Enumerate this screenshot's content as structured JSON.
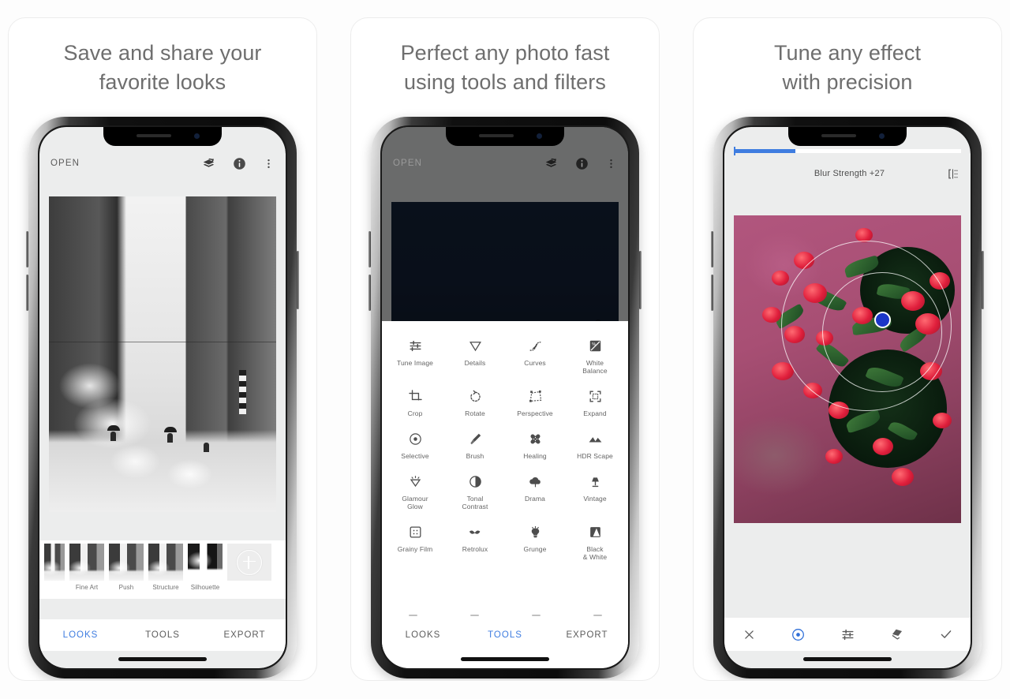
{
  "page": {
    "background": "#fdfdfd",
    "accent": "#3f7de0"
  },
  "cards": [
    {
      "id": "looks",
      "title": "Save and share your\nfavorite looks",
      "appbar": {
        "open_label": "OPEN",
        "icons": [
          "stack-undo-icon",
          "info-icon",
          "overflow-menu-icon"
        ]
      },
      "photo_alt": "black and white city street with steam",
      "looks": [
        {
          "label": "Fine Art"
        },
        {
          "label": "Push"
        },
        {
          "label": "Structure"
        },
        {
          "label": "Silhouette"
        }
      ],
      "add_look": "+",
      "tabs": [
        {
          "label": "LOOKS",
          "active": true
        },
        {
          "label": "TOOLS",
          "active": false
        },
        {
          "label": "EXPORT",
          "active": false
        }
      ]
    },
    {
      "id": "tools",
      "title": "Perfect any photo fast\nusing tools and filters",
      "appbar": {
        "open_label": "OPEN",
        "icons": [
          "stack-undo-icon",
          "info-icon",
          "overflow-menu-icon"
        ]
      },
      "tools": [
        {
          "label": "Tune Image",
          "icon": "sliders-icon"
        },
        {
          "label": "Details",
          "icon": "triangle-down-icon"
        },
        {
          "label": "Curves",
          "icon": "curve-icon"
        },
        {
          "label": "White\nBalance",
          "icon": "white-balance-icon"
        },
        {
          "label": "Crop",
          "icon": "crop-icon"
        },
        {
          "label": "Rotate",
          "icon": "rotate-icon"
        },
        {
          "label": "Perspective",
          "icon": "perspective-icon"
        },
        {
          "label": "Expand",
          "icon": "expand-icon"
        },
        {
          "label": "Selective",
          "icon": "selective-icon"
        },
        {
          "label": "Brush",
          "icon": "brush-icon"
        },
        {
          "label": "Healing",
          "icon": "healing-icon"
        },
        {
          "label": "HDR Scape",
          "icon": "mountains-icon"
        },
        {
          "label": "Glamour\nGlow",
          "icon": "glamour-glow-icon"
        },
        {
          "label": "Tonal\nContrast",
          "icon": "contrast-icon"
        },
        {
          "label": "Drama",
          "icon": "cloud-icon"
        },
        {
          "label": "Vintage",
          "icon": "lamp-icon"
        },
        {
          "label": "Grainy Film",
          "icon": "grain-icon"
        },
        {
          "label": "Retrolux",
          "icon": "mustache-icon"
        },
        {
          "label": "Grunge",
          "icon": "grunge-icon"
        },
        {
          "label": "Black\n& White",
          "icon": "black-white-icon"
        }
      ],
      "tabs": [
        {
          "label": "LOOKS",
          "active": false
        },
        {
          "label": "TOOLS",
          "active": true
        },
        {
          "label": "EXPORT",
          "active": false
        }
      ]
    },
    {
      "id": "tune",
      "title": "Tune any effect\nwith precision",
      "slider": {
        "value_percent": 27
      },
      "param_label": "Blur Strength +27",
      "compare_icon": "compare-icon",
      "photo_alt": "red crown of thorns flowers on pink background",
      "control_point": {
        "label": "control-point"
      },
      "toolbar": [
        {
          "icon": "close-icon",
          "label": "Cancel",
          "active": false
        },
        {
          "icon": "selective-target-icon",
          "label": "Control point",
          "active": true
        },
        {
          "icon": "sliders-icon",
          "label": "Adjust",
          "active": false
        },
        {
          "icon": "stack-layers-icon",
          "label": "Stacks",
          "active": false
        },
        {
          "icon": "check-icon",
          "label": "Apply",
          "active": false
        }
      ]
    }
  ]
}
